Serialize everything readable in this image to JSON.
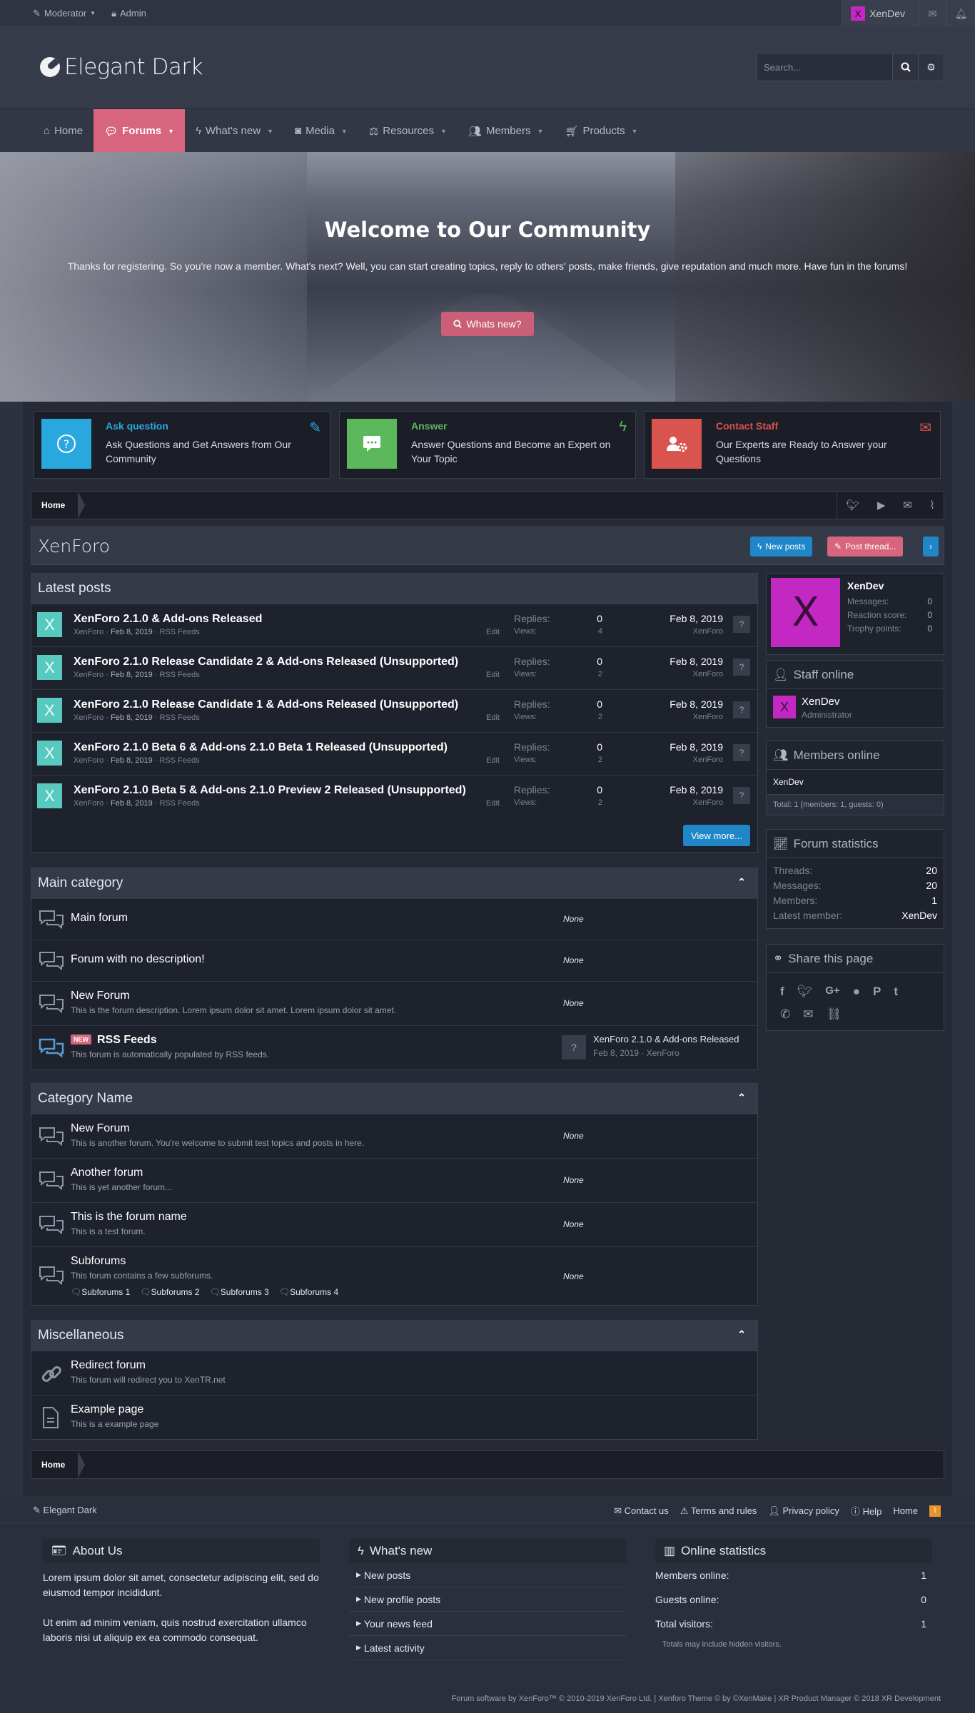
{
  "adminbar": {
    "moderator": "Moderator",
    "admin": "Admin",
    "user": "XenDev",
    "user_initial": "X"
  },
  "header": {
    "logo": "Elegant Dark",
    "search_placeholder": "Search..."
  },
  "nav": [
    "Home",
    "Forums",
    "What's new",
    "Media",
    "Resources",
    "Members",
    "Products"
  ],
  "hero": {
    "title": "Welcome to Our Community",
    "text": "Thanks for registering. So you're now a member. What's next? Well, you can start creating topics, reply to others' posts, make friends, give reputation and much more. Have fun in the forums!",
    "button": "Whats new?"
  },
  "features": [
    {
      "title": "Ask question",
      "desc": "Ask Questions and Get Answers from Our Community",
      "color": "#29a8e0"
    },
    {
      "title": "Answer",
      "desc": "Answer Questions and Become an Expert on Your Topic",
      "color": "#5cb85c"
    },
    {
      "title": "Contact Staff",
      "desc": "Our Experts are Ready to Answer your Questions",
      "color": "#d9534f"
    }
  ],
  "breadcrumb": "Home",
  "page": {
    "title": "XenForo",
    "new_posts": "New posts",
    "post_thread": "Post thread..."
  },
  "latest": {
    "title": "Latest posts",
    "replies_label": "Replies:",
    "views_label": "Views:",
    "edit_label": "Edit",
    "rows": [
      {
        "title": "XenForo 2.1.0 & Add-ons Released",
        "author": "XenForo",
        "date": "Feb 8, 2019",
        "forum": "RSS Feeds",
        "replies": "0",
        "views": "4",
        "last_date": "Feb 8, 2019",
        "last_by": "XenForo"
      },
      {
        "title": "XenForo 2.1.0 Release Candidate 2 & Add-ons Released (Unsupported)",
        "author": "XenForo",
        "date": "Feb 8, 2019",
        "forum": "RSS Feeds",
        "replies": "0",
        "views": "2",
        "last_date": "Feb 8, 2019",
        "last_by": "XenForo"
      },
      {
        "title": "XenForo 2.1.0 Release Candidate 1 & Add-ons Released (Unsupported)",
        "author": "XenForo",
        "date": "Feb 8, 2019",
        "forum": "RSS Feeds",
        "replies": "0",
        "views": "2",
        "last_date": "Feb 8, 2019",
        "last_by": "XenForo"
      },
      {
        "title": "XenForo 2.1.0 Beta 6 & Add-ons 2.1.0 Beta 1 Released (Unsupported)",
        "author": "XenForo",
        "date": "Feb 8, 2019",
        "forum": "RSS Feeds",
        "replies": "0",
        "views": "2",
        "last_date": "Feb 8, 2019",
        "last_by": "XenForo"
      },
      {
        "title": "XenForo 2.1.0 Beta 5 & Add-ons 2.1.0 Preview 2 Released (Unsupported)",
        "author": "XenForo",
        "date": "Feb 8, 2019",
        "forum": "RSS Feeds",
        "replies": "0",
        "views": "2",
        "last_date": "Feb 8, 2019",
        "last_by": "XenForo"
      }
    ],
    "view_more": "View more..."
  },
  "main_category": {
    "title": "Main category",
    "forums": [
      {
        "name": "Main forum",
        "desc": "",
        "last": "None"
      },
      {
        "name": "Forum with no description!",
        "desc": "",
        "last": "None"
      },
      {
        "name": "New Forum",
        "desc": "This is the forum description. Lorem ipsum dolor sit amet. Lorem ipsum dolor sit amet.",
        "last": "None"
      },
      {
        "name": "RSS Feeds",
        "desc": "This forum is automatically populated by RSS feeds.",
        "badge": "NEW",
        "last_title": "XenForo 2.1.0 & Add-ons Released",
        "last_meta": "Feb 8, 2019 · XenForo"
      }
    ]
  },
  "category_name": {
    "title": "Category Name",
    "forums": [
      {
        "name": "New Forum",
        "desc": "This is another forum. You're welcome to submit test topics and posts in here.",
        "last": "None"
      },
      {
        "name": "Another forum",
        "desc": "This is yet another forum...",
        "last": "None"
      },
      {
        "name": "This is the forum name",
        "desc": "This is a test forum.",
        "last": "None"
      },
      {
        "name": "Subforums",
        "desc": "This forum contains a few subforums.",
        "last": "None"
      }
    ],
    "subforums": [
      "Subforums 1",
      "Subforums 2",
      "Subforums 3",
      "Subforums 4"
    ]
  },
  "misc": {
    "title": "Miscellaneous",
    "forums": [
      {
        "name": "Redirect forum",
        "desc": "This forum will redirect you to XenTR.net"
      },
      {
        "name": "Example page",
        "desc": "This is a example page"
      }
    ]
  },
  "sidebar": {
    "user": {
      "name": "XenDev",
      "initial": "X",
      "messages_label": "Messages:",
      "messages": "0",
      "reaction_label": "Reaction score:",
      "reaction": "0",
      "trophy_label": "Trophy points:",
      "trophy": "0"
    },
    "staff": {
      "title": "Staff online",
      "name": "XenDev",
      "role": "Administrator",
      "initial": "X"
    },
    "members": {
      "title": "Members online",
      "name": "XenDev",
      "total": "Total: 1 (members: 1, guests: 0)"
    },
    "stats": {
      "title": "Forum statistics",
      "rows": [
        [
          "Threads:",
          "20"
        ],
        [
          "Messages:",
          "20"
        ],
        [
          "Members:",
          "1"
        ],
        [
          "Latest member:",
          "XenDev"
        ]
      ]
    },
    "share": {
      "title": "Share this page"
    }
  },
  "footer": {
    "brand": "Elegant Dark",
    "links": [
      "Contact us",
      "Terms and rules",
      "Privacy policy",
      "Help",
      "Home"
    ],
    "about_title": "About Us",
    "about_p1": "Lorem ipsum dolor sit amet, consectetur adipiscing elit, sed do eiusmod tempor incididunt.",
    "about_p2": "Ut enim ad minim veniam, quis nostrud exercitation ullamco laboris nisi ut aliquip ex ea commodo consequat.",
    "whatsnew_title": "What's new",
    "whatsnew": [
      "New posts",
      "New profile posts",
      "Your news feed",
      "Latest activity"
    ],
    "stats_title": "Online statistics",
    "stats": [
      [
        "Members online:",
        "1"
      ],
      [
        "Guests online:",
        "0"
      ],
      [
        "Total visitors:",
        "1"
      ]
    ],
    "stats_note": "Totals may include hidden visitors.",
    "copyright": "Forum software by XenForo™ © 2010-2019 XenForo Ltd. | Xenforo Theme © by ©XenMake | XR Product Manager © 2018 XR Development"
  }
}
